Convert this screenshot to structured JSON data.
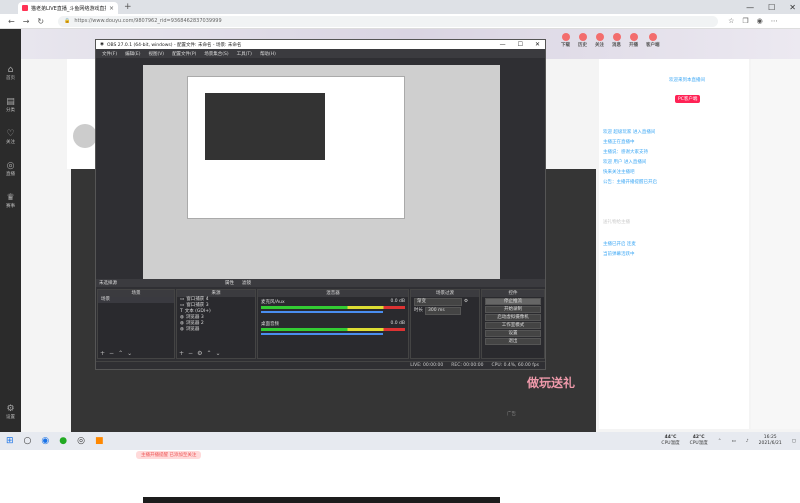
{
  "browser": {
    "tab_title": "猫老弟LIVE直播_斗鱼网络游戏直播平台",
    "tab_close": "×",
    "new_tab": "+",
    "url": "https://www.douyu.com/9807962_rid=9368462837039999",
    "win_min": "—",
    "win_max": "☐",
    "win_close": "✕"
  },
  "sidebar": {
    "items": [
      {
        "icon": "⌂",
        "label": "首页"
      },
      {
        "icon": "▤",
        "label": "分类"
      },
      {
        "icon": "♡",
        "label": "关注"
      },
      {
        "icon": "◎",
        "label": "直播"
      },
      {
        "icon": "♛",
        "label": "赛事"
      }
    ],
    "bottom_label": "设置"
  },
  "page": {
    "top_links": [
      "下载",
      "历史",
      "关注",
      "消息",
      "开播",
      "客户端"
    ],
    "pc_download": "PC客户端",
    "chat": [
      "欢迎来到本直播间",
      "欢迎 超级玩家 进入直播间",
      "主播正在直播中",
      "主播说：感谢大家支持",
      "欢迎 用户 进入直播间",
      "快来关注主播吧",
      "公告：主播开播提醒已开启",
      "送礼物给主播",
      "主播已开启 连麦",
      "当前弹幕活跃中"
    ],
    "gift_text": "做玩送礼",
    "ad_label": "广告",
    "toast": "主播开播提醒 已添加至关注"
  },
  "obs": {
    "title": "OBS 27.0.1 (64-bit, windows) - 配置文件: 未命名 - 场景: 未命名",
    "menu": [
      "文件(F)",
      "编辑(E)",
      "视图(V)",
      "配置文件(P)",
      "场景集合(S)",
      "工具(T)",
      "帮助(H)"
    ],
    "scene_bar": [
      "未选择源",
      "属性",
      "滤镜"
    ],
    "docks": {
      "scenes": {
        "title": "场景",
        "items": [
          "场景"
        ]
      },
      "sources": {
        "title": "来源",
        "items": [
          "窗口捕获 4",
          "窗口捕获 3",
          "文本 (GDI+)",
          "浏览器 3",
          "浏览器 2",
          "浏览器"
        ]
      },
      "mixer": {
        "title": "混音器",
        "channels": [
          {
            "name": "麦克风/Aux",
            "db": "0.0 dB"
          },
          {
            "name": "桌面音频",
            "db": "0.0 dB"
          }
        ]
      },
      "transitions": {
        "title": "场景过渡",
        "type": "渐变",
        "duration_label": "时长",
        "duration": "300 ms"
      },
      "controls": {
        "title": "控件",
        "buttons": [
          "停止推流",
          "开始录制",
          "启动虚拟摄像机",
          "工作室模式",
          "设置",
          "退出"
        ]
      }
    },
    "status": {
      "live_label": "LIVE: 00:00:00",
      "rec_label": "REC: 00:00:00",
      "cpu": "CPU: 0.4%, 60.00 fps"
    }
  },
  "taskbar": {
    "cpu1_temp": "44°C",
    "cpu1_label": "CPU温度",
    "cpu2_temp": "42°C",
    "cpu2_label": "CPU温度",
    "time": "16:25",
    "date": "2021/6/21"
  }
}
